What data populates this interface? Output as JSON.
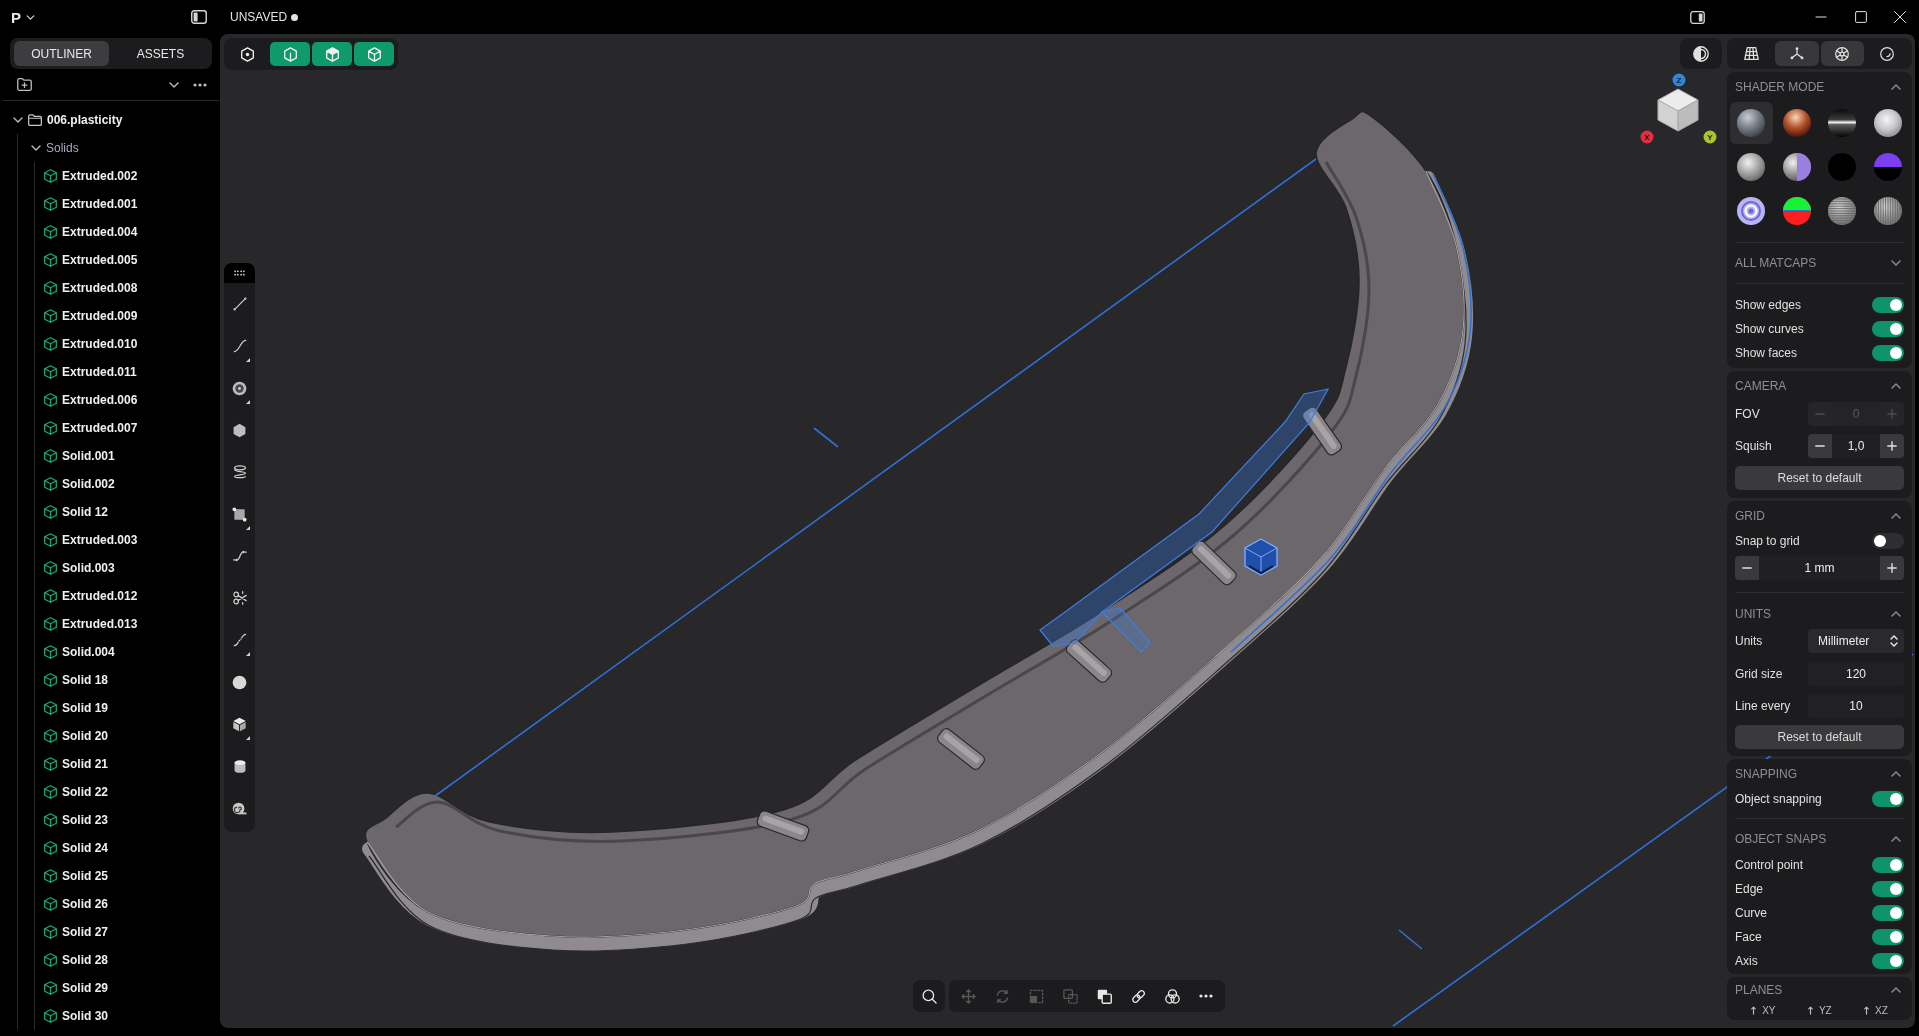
{
  "title_bar": {
    "logo": "P",
    "document_title": "UNSAVED",
    "unsaved": true
  },
  "sidebar": {
    "tabs": [
      {
        "label": "OUTLINER",
        "selected": true
      },
      {
        "label": "ASSETS",
        "selected": false
      }
    ],
    "tree": [
      {
        "label": "006.plasticity",
        "kind": "folder",
        "expanded": true,
        "children": [
          {
            "label": "Solids",
            "kind": "group",
            "expanded": true,
            "children": [
              {
                "label": "Extruded.002",
                "kind": "solid"
              },
              {
                "label": "Extruded.001",
                "kind": "solid"
              },
              {
                "label": "Extruded.004",
                "kind": "solid"
              },
              {
                "label": "Extruded.005",
                "kind": "solid"
              },
              {
                "label": "Extruded.008",
                "kind": "solid"
              },
              {
                "label": "Extruded.009",
                "kind": "solid"
              },
              {
                "label": "Extruded.010",
                "kind": "solid"
              },
              {
                "label": "Extruded.011",
                "kind": "solid"
              },
              {
                "label": "Extruded.006",
                "kind": "solid"
              },
              {
                "label": "Extruded.007",
                "kind": "solid"
              },
              {
                "label": "Solid.001",
                "kind": "solid"
              },
              {
                "label": "Solid.002",
                "kind": "solid"
              },
              {
                "label": "Solid 12",
                "kind": "solid"
              },
              {
                "label": "Extruded.003",
                "kind": "solid"
              },
              {
                "label": "Solid.003",
                "kind": "solid"
              },
              {
                "label": "Extruded.012",
                "kind": "solid"
              },
              {
                "label": "Extruded.013",
                "kind": "solid"
              },
              {
                "label": "Solid.004",
                "kind": "solid"
              },
              {
                "label": "Solid 18",
                "kind": "solid"
              },
              {
                "label": "Solid 19",
                "kind": "solid"
              },
              {
                "label": "Solid 20",
                "kind": "solid"
              },
              {
                "label": "Solid 21",
                "kind": "solid"
              },
              {
                "label": "Solid 22",
                "kind": "solid"
              },
              {
                "label": "Solid 23",
                "kind": "solid"
              },
              {
                "label": "Solid 24",
                "kind": "solid"
              },
              {
                "label": "Solid 25",
                "kind": "solid"
              },
              {
                "label": "Solid 26",
                "kind": "solid"
              },
              {
                "label": "Solid 27",
                "kind": "solid"
              },
              {
                "label": "Solid 28",
                "kind": "solid"
              },
              {
                "label": "Solid 29",
                "kind": "solid"
              },
              {
                "label": "Solid 30",
                "kind": "solid"
              }
            ]
          }
        ]
      }
    ]
  },
  "viewport": {
    "selection_modes": [
      {
        "kind": "hexdot",
        "selected": false
      },
      {
        "kind": "half",
        "selected": true
      },
      {
        "kind": "shaded",
        "selected": true
      },
      {
        "kind": "outline",
        "selected": true
      }
    ],
    "view_cube": {
      "axes": [
        {
          "label": "Z",
          "color": "#2f86e0"
        },
        {
          "label": "X",
          "color": "#e0303f"
        },
        {
          "label": "Y",
          "color": "#a9c22f"
        }
      ]
    },
    "tools": [
      {
        "kind": "line",
        "submenu": false
      },
      {
        "kind": "curve",
        "submenu": true
      },
      {
        "kind": "circle",
        "submenu": true
      },
      {
        "kind": "polygon",
        "submenu": false
      },
      {
        "kind": "coil",
        "submenu": false
      },
      {
        "kind": "rectangle",
        "submenu": true
      },
      {
        "kind": "spline",
        "submenu": false
      },
      {
        "kind": "scissors",
        "submenu": false
      },
      {
        "kind": "bridge",
        "submenu": true
      },
      {
        "kind": "sphere",
        "submenu": false
      },
      {
        "kind": "box",
        "submenu": true
      },
      {
        "kind": "cylinder",
        "submenu": false
      },
      {
        "kind": "tape",
        "submenu": false
      }
    ],
    "bottom_toolbar": [
      {
        "kind": "search",
        "disabled": false
      },
      {
        "kind": "move",
        "disabled": true
      },
      {
        "kind": "rotate",
        "disabled": true
      },
      {
        "kind": "scale",
        "disabled": true
      },
      {
        "kind": "duplicate",
        "disabled": true
      },
      {
        "kind": "boolean",
        "disabled": false
      },
      {
        "kind": "link",
        "disabled": false
      },
      {
        "kind": "venn",
        "disabled": false
      },
      {
        "kind": "more",
        "disabled": false
      }
    ]
  },
  "panel": {
    "tabs": [
      {
        "kind": "grid",
        "selected": false
      },
      {
        "kind": "axes",
        "selected": true
      },
      {
        "kind": "wheel",
        "selected": true
      },
      {
        "kind": "sphere",
        "selected": false
      }
    ],
    "shader_mode": {
      "title": "SHADER MODE",
      "expanded": true,
      "matcaps": [
        {
          "kind": "grey",
          "selected": true
        },
        {
          "kind": "copper",
          "selected": false
        },
        {
          "kind": "chrome",
          "selected": false
        },
        {
          "kind": "pearl",
          "selected": false
        },
        {
          "kind": "silver",
          "selected": false
        },
        {
          "kind": "lilac",
          "selected": false
        },
        {
          "kind": "black",
          "selected": false
        },
        {
          "kind": "purple",
          "selected": false
        },
        {
          "kind": "rings",
          "selected": false
        },
        {
          "kind": "rgb",
          "selected": false
        },
        {
          "kind": "hstripes",
          "selected": false
        },
        {
          "kind": "vstripes",
          "selected": false
        }
      ],
      "all_matcaps": {
        "title": "ALL MATCAPS",
        "expanded": false
      },
      "toggles": [
        {
          "label": "Show edges",
          "on": true
        },
        {
          "label": "Show curves",
          "on": true
        },
        {
          "label": "Show faces",
          "on": true
        }
      ]
    },
    "camera": {
      "title": "CAMERA",
      "expanded": true,
      "steppers": [
        {
          "label": "FOV",
          "value": "0",
          "disabled": true
        },
        {
          "label": "Squish",
          "value": "1,0",
          "disabled": false
        }
      ],
      "reset": "Reset to default"
    },
    "grid": {
      "title": "GRID",
      "expanded": true,
      "snap": {
        "label": "Snap to grid",
        "on": false
      },
      "step": "1 mm"
    },
    "units": {
      "title": "UNITS",
      "expanded": true,
      "fields": [
        {
          "label": "Units",
          "kind": "select",
          "value": "Millimeter"
        },
        {
          "label": "Grid size",
          "kind": "number",
          "value": "120"
        },
        {
          "label": "Line every",
          "kind": "number",
          "value": "10"
        }
      ],
      "reset": "Reset to default"
    },
    "snapping": {
      "title": "SNAPPING",
      "expanded": true,
      "toggles": [
        {
          "label": "Object snapping",
          "on": true
        }
      ]
    },
    "object_snaps": {
      "title": "OBJECT SNAPS",
      "expanded": true,
      "toggles": [
        {
          "label": "Control point",
          "on": true
        },
        {
          "label": "Edge",
          "on": true
        },
        {
          "label": "Curve",
          "on": true
        },
        {
          "label": "Face",
          "on": true
        },
        {
          "label": "Axis",
          "on": true
        }
      ]
    },
    "planes": {
      "title": "PLANES",
      "expanded": true,
      "items": [
        {
          "label": "XY"
        },
        {
          "label": "YZ"
        },
        {
          "label": "XZ"
        }
      ]
    }
  }
}
